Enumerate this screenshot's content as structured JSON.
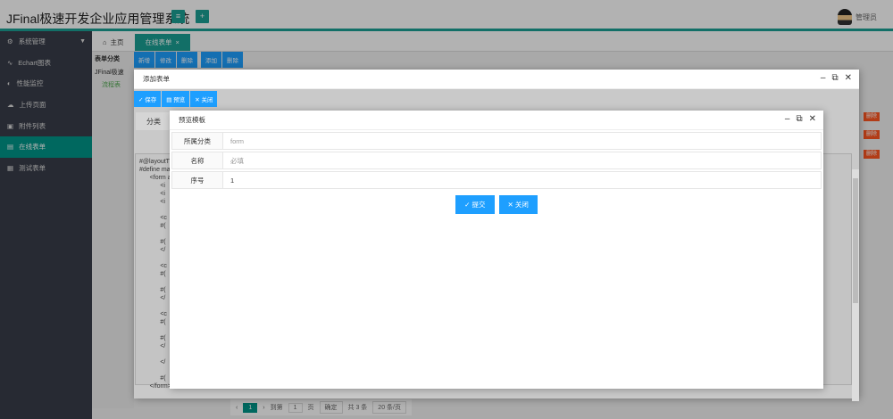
{
  "header": {
    "title": "JFinal极速开发企业应用管理系统",
    "menu_icon": "≡",
    "add_icon": "+",
    "user": "管理员"
  },
  "sidebar": {
    "items": [
      {
        "label": "系统管理",
        "icon": "⚙"
      },
      {
        "label": "Echart图表",
        "icon": "∿"
      },
      {
        "label": "性能监控",
        "icon": "◐"
      },
      {
        "label": "上传页面",
        "icon": "☁"
      },
      {
        "label": "附件列表",
        "icon": "▣"
      },
      {
        "label": "在线表单",
        "icon": "▤"
      },
      {
        "label": "测试表单",
        "icon": "▦"
      }
    ]
  },
  "tabs": [
    {
      "label": "主页"
    },
    {
      "label": "在线表单"
    }
  ],
  "background": {
    "tree_title": "表单分类",
    "tree_root": "JFinal极速",
    "tree_leaf": "流程表",
    "toolbar": [
      "新增",
      "修改",
      "删除",
      "添加",
      "删除"
    ],
    "col_label": "分类",
    "code": "#@layoutT(\n#define mai\n      <form a\n            <i\n            <i\n            <i\n\n            <c\n            #(\n\n            #(\n            </\n\n            <c\n            #(\n\n            #(\n            </\n\n            <c\n            #(\n\n            #(\n            </\n\n            </\n\n            #(\n      </form>",
    "delete": "删除",
    "pager": {
      "prev": "‹",
      "page": "1",
      "next": "›",
      "goto": "到第",
      "input": "1",
      "page_unit": "页",
      "confirm": "确定",
      "total": "共 3 条",
      "size": "20 条/页"
    }
  },
  "outer_dialog": {
    "title": "添加表单",
    "toolbar": [
      "保存",
      "预览",
      "关闭"
    ],
    "field_label": "分类"
  },
  "inner_dialog": {
    "title": "预览模板",
    "fields": [
      {
        "label": "所属分类",
        "value": "form",
        "placeholder": true
      },
      {
        "label": "名称",
        "value": "必填",
        "placeholder": true
      },
      {
        "label": "序号",
        "value": "1",
        "placeholder": false
      }
    ],
    "submit": "提交",
    "close": "关闭"
  }
}
